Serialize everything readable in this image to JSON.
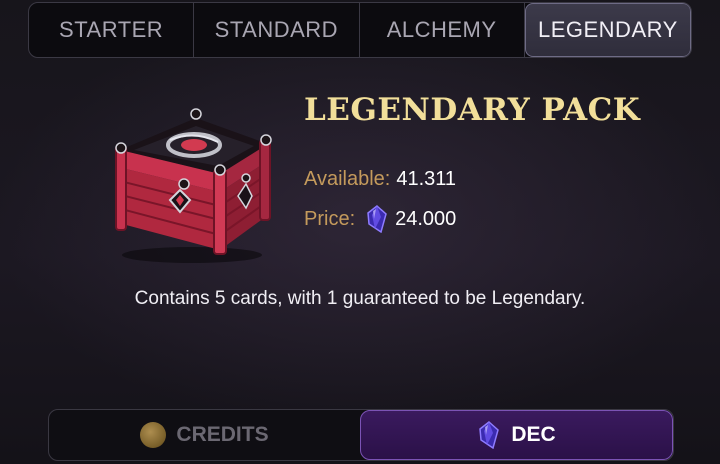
{
  "tabs": [
    {
      "label": "STARTER",
      "active": false
    },
    {
      "label": "STANDARD",
      "active": false
    },
    {
      "label": "ALCHEMY",
      "active": false
    },
    {
      "label": "LEGENDARY",
      "active": true
    }
  ],
  "pack": {
    "title": "LEGENDARY PACK",
    "available_label": "Available:",
    "available_value": "41.311",
    "price_label": "Price:",
    "price_value": "24.000",
    "price_icon": "dec-gem-icon",
    "description": "Contains 5 cards, with 1 guaranteed to be Legendary."
  },
  "currency": {
    "credits_label": "CREDITS",
    "dec_label": "DEC",
    "selected": "DEC"
  },
  "colors": {
    "title_gold": "#f2df9a",
    "label_gold": "#c49a5c",
    "chest_red": "#c8324e",
    "dec_purple": "#3a1a5e"
  }
}
